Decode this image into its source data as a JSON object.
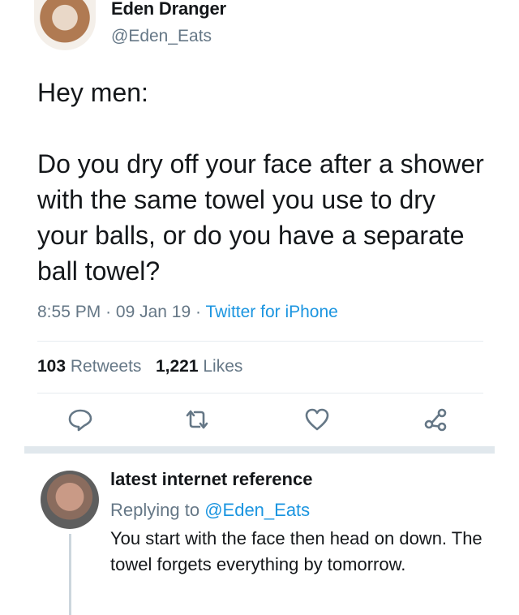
{
  "tweet": {
    "author_name": "Eden Dranger",
    "author_handle": "@Eden_Eats",
    "text": "Hey men:\n\nDo you dry off your face after a shower with the same towel you use to dry your balls, or do you have a separate ball towel?",
    "time": "8:55 PM",
    "date": "09 Jan 19",
    "source": "Twitter for iPhone",
    "retweets_count": "103",
    "retweets_label": "Retweets",
    "likes_count": "1,221",
    "likes_label": "Likes",
    "actions": [
      "reply-icon",
      "retweet-icon",
      "like-icon",
      "share-icon"
    ]
  },
  "reply": {
    "author_name": "latest internet reference",
    "replying_prefix": "Replying to",
    "replying_mention": "@Eden_Eats",
    "text": "You start with the face then head on down. The towel forgets everything by tomorrow."
  },
  "colors": {
    "text": "#14171a",
    "secondary": "#657786",
    "link": "#1b95e0",
    "divider": "#e6ecf0",
    "band": "#e1e8ed"
  }
}
